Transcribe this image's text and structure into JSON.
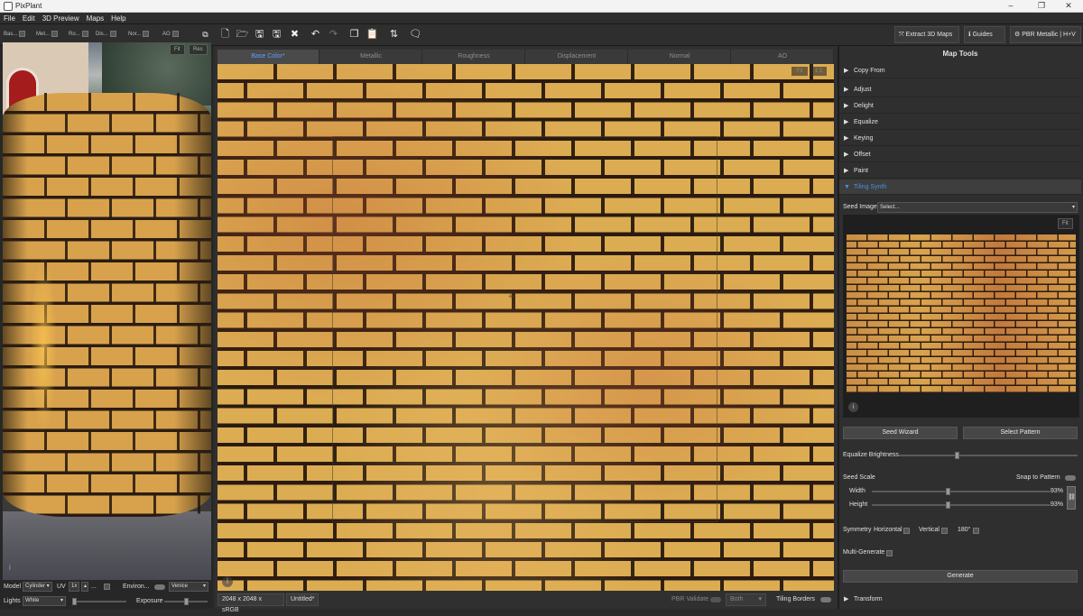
{
  "window": {
    "title": "PixPlant",
    "minimize": "–",
    "maximize": "❐",
    "close": "✕"
  },
  "menu": [
    "File",
    "Edit",
    "3D Preview",
    "Maps",
    "Help"
  ],
  "toolbar": {
    "map_toggles": [
      "Bas...",
      "Met...",
      "Ro...",
      "Dis...",
      "Nor...",
      "AO"
    ],
    "extract_3d_maps": "Extract 3D Maps",
    "guides": "Guides",
    "pbr_mode": "PBR Metallic | H+V"
  },
  "preview3d": {
    "fit": "Fit",
    "res": "Res",
    "model_label": "Model",
    "model_value": "Cylinder",
    "uv_label": "UV",
    "uv_value": "1x",
    "uv_more": "...",
    "environ_label": "Environ...",
    "environ_value": "Venice",
    "lights_label": "Lights",
    "lights_value": "White",
    "exposure_label": "Exposure",
    "info": "i"
  },
  "map_tabs": [
    "Base Color*",
    "Metallic",
    "Roughness",
    "Displacement",
    "Normal",
    "AO"
  ],
  "active_tab": "Base Color*",
  "canvas": {
    "info": "i",
    "zoom_a": "Fit",
    "zoom_b": "1:1"
  },
  "status": {
    "resolution": "2048 x 2048 x sRGB",
    "file": "Untitled*",
    "pbr_validate": "PBR Validate",
    "both": "Both",
    "tiling_borders": "Tiling Borders"
  },
  "map_tools": {
    "title": "Map Tools",
    "sections": [
      "Copy From",
      "Adjust",
      "Delight",
      "Equalize",
      "Keying",
      "Offset",
      "Paint"
    ],
    "active_section": "Tiling Synth",
    "transform": "Transform"
  },
  "tiling_synth": {
    "seed_image_label": "Seed Image",
    "seed_image_value": "Select...",
    "fit": "Fit",
    "info": "i",
    "seed_wizard": "Seed Wizard",
    "select_pattern": "Select Pattern",
    "equalize_brightness": "Equalize Brightness",
    "seed_scale": "Seed Scale",
    "snap_to_pattern": "Snap to Pattern",
    "width_label": "Width",
    "width_value": "93%",
    "height_label": "Height",
    "height_value": "93%",
    "symmetry_label": "Symmetry",
    "horizontal": "Horizontal",
    "vertical": "Vertical",
    "rot180": "180°",
    "multi_generate": "Multi-Generate",
    "generate": "Generate"
  },
  "colors": {
    "accent": "#4a8fe0",
    "brick": "#dcac52",
    "mortar": "#2a1a10"
  }
}
